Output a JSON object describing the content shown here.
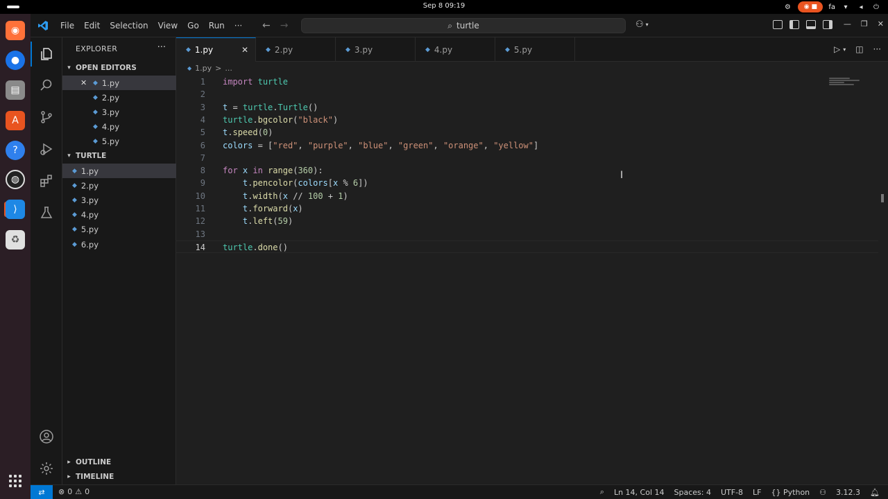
{
  "system": {
    "clock": "Sep 8  09:19",
    "language": "fa"
  },
  "app": {
    "menu": [
      "File",
      "Edit",
      "Selection",
      "View",
      "Go",
      "Run"
    ],
    "menu_more": "···",
    "search_text": "turtle"
  },
  "explorer": {
    "title": "EXPLORER",
    "more": "···",
    "open_editors_label": "OPEN EDITORS",
    "open_editors": [
      "1.py",
      "2.py",
      "3.py",
      "4.py",
      "5.py"
    ],
    "folder_label": "TURTLE",
    "files": [
      "1.py",
      "2.py",
      "3.py",
      "4.py",
      "5.py",
      "6.py"
    ],
    "outline_label": "OUTLINE",
    "timeline_label": "TIMELINE"
  },
  "tabs": [
    "1.py",
    "2.py",
    "3.py",
    "4.py",
    "5.py"
  ],
  "active_tab": "1.py",
  "breadcrumb": {
    "file": "1.py",
    "sep": ">",
    "rest": "..."
  },
  "editor": {
    "current_line": 14,
    "lines": [
      {
        "n": "1",
        "tokens": [
          [
            "kw",
            "import"
          ],
          [
            "p",
            " "
          ],
          [
            "mod",
            "turtle"
          ]
        ]
      },
      {
        "n": "2",
        "tokens": []
      },
      {
        "n": "3",
        "tokens": [
          [
            "var",
            "t"
          ],
          [
            "p",
            " = "
          ],
          [
            "mod",
            "turtle"
          ],
          [
            "p",
            "."
          ],
          [
            "cls",
            "Turtle"
          ],
          [
            "p",
            "()"
          ]
        ]
      },
      {
        "n": "4",
        "tokens": [
          [
            "mod",
            "turtle"
          ],
          [
            "p",
            "."
          ],
          [
            "fn",
            "bgcolor"
          ],
          [
            "p",
            "("
          ],
          [
            "str",
            "\"black\""
          ],
          [
            "p",
            ")"
          ]
        ]
      },
      {
        "n": "5",
        "tokens": [
          [
            "var",
            "t"
          ],
          [
            "p",
            "."
          ],
          [
            "fn",
            "speed"
          ],
          [
            "p",
            "("
          ],
          [
            "num",
            "0"
          ],
          [
            "p",
            ")"
          ]
        ]
      },
      {
        "n": "6",
        "tokens": [
          [
            "var",
            "colors"
          ],
          [
            "p",
            " = ["
          ],
          [
            "str",
            "\"red\""
          ],
          [
            "p",
            ", "
          ],
          [
            "str",
            "\"purple\""
          ],
          [
            "p",
            ", "
          ],
          [
            "str",
            "\"blue\""
          ],
          [
            "p",
            ", "
          ],
          [
            "str",
            "\"green\""
          ],
          [
            "p",
            ", "
          ],
          [
            "str",
            "\"orange\""
          ],
          [
            "p",
            ", "
          ],
          [
            "str",
            "\"yellow\""
          ],
          [
            "p",
            "]"
          ]
        ]
      },
      {
        "n": "7",
        "tokens": []
      },
      {
        "n": "8",
        "tokens": [
          [
            "kw",
            "for"
          ],
          [
            "p",
            " "
          ],
          [
            "var",
            "x"
          ],
          [
            "p",
            " "
          ],
          [
            "kw",
            "in"
          ],
          [
            "p",
            " "
          ],
          [
            "fn",
            "range"
          ],
          [
            "p",
            "("
          ],
          [
            "num",
            "360"
          ],
          [
            "p",
            "):"
          ]
        ]
      },
      {
        "n": "9",
        "tokens": [
          [
            "p",
            "    "
          ],
          [
            "var",
            "t"
          ],
          [
            "p",
            "."
          ],
          [
            "fn",
            "pencolor"
          ],
          [
            "p",
            "("
          ],
          [
            "var",
            "colors"
          ],
          [
            "p",
            "["
          ],
          [
            "var",
            "x"
          ],
          [
            "p",
            " % "
          ],
          [
            "num",
            "6"
          ],
          [
            "p",
            "])"
          ]
        ]
      },
      {
        "n": "10",
        "tokens": [
          [
            "p",
            "    "
          ],
          [
            "var",
            "t"
          ],
          [
            "p",
            "."
          ],
          [
            "fn",
            "width"
          ],
          [
            "p",
            "("
          ],
          [
            "var",
            "x"
          ],
          [
            "p",
            " // "
          ],
          [
            "num",
            "100"
          ],
          [
            "p",
            " + "
          ],
          [
            "num",
            "1"
          ],
          [
            "p",
            ")"
          ]
        ]
      },
      {
        "n": "11",
        "tokens": [
          [
            "p",
            "    "
          ],
          [
            "var",
            "t"
          ],
          [
            "p",
            "."
          ],
          [
            "fn",
            "forward"
          ],
          [
            "p",
            "("
          ],
          [
            "var",
            "x"
          ],
          [
            "p",
            ")"
          ]
        ]
      },
      {
        "n": "12",
        "tokens": [
          [
            "p",
            "    "
          ],
          [
            "var",
            "t"
          ],
          [
            "p",
            "."
          ],
          [
            "fn",
            "left"
          ],
          [
            "p",
            "("
          ],
          [
            "num",
            "59"
          ],
          [
            "p",
            ")"
          ]
        ]
      },
      {
        "n": "13",
        "tokens": []
      },
      {
        "n": "14",
        "tokens": [
          [
            "mod",
            "turtle"
          ],
          [
            "p",
            "."
          ],
          [
            "fn",
            "done"
          ],
          [
            "p",
            "()"
          ]
        ]
      }
    ]
  },
  "status": {
    "errors": "0",
    "warnings": "0",
    "position": "Ln 14, Col 14",
    "spaces": "Spaces: 4",
    "encoding": "UTF-8",
    "eol": "LF",
    "language": "Python",
    "version": "3.12.3"
  },
  "colors": {
    "accent": "#0078d4",
    "ubuntu_orange": "#e95420"
  }
}
